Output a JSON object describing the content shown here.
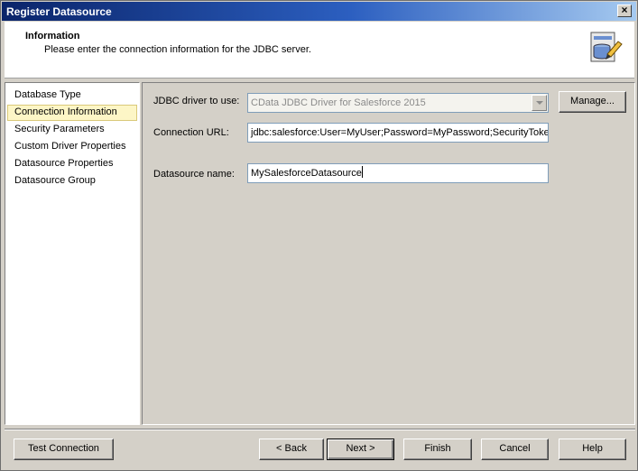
{
  "window": {
    "title": "Register Datasource"
  },
  "header": {
    "title": "Information",
    "description": "Please enter the connection information for the JDBC server."
  },
  "sidebar": {
    "items": [
      {
        "label": "Database Type"
      },
      {
        "label": "Connection Information",
        "selected": true
      },
      {
        "label": "Security Parameters"
      },
      {
        "label": "Custom Driver Properties"
      },
      {
        "label": "Datasource Properties"
      },
      {
        "label": "Datasource Group"
      }
    ]
  },
  "form": {
    "driver_label": "JDBC driver to use:",
    "driver_value": "CData JDBC Driver for Salesforce 2015",
    "manage_label": "Manage...",
    "url_label": "Connection URL:",
    "url_value": "jdbc:salesforce:User=MyUser;Password=MyPassword;SecurityToken=",
    "name_label": "Datasource name:",
    "name_value": "MySalesforceDatasource"
  },
  "buttons": {
    "test_connection": "Test Connection",
    "back": "< Back",
    "next": "Next >",
    "finish": "Finish",
    "cancel": "Cancel",
    "help": "Help"
  },
  "icons": {
    "close": "close-icon",
    "header": "database-edit-icon",
    "combo": "chevron-down-icon"
  }
}
